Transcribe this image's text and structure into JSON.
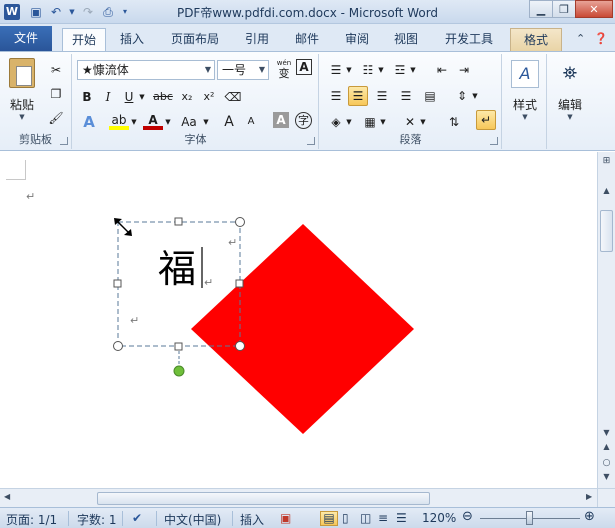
{
  "window": {
    "title": "PDF帝www.pdfdi.com.docx  -  Microsoft Word",
    "app_icon_letter": "W",
    "qat": [
      "save-icon",
      "undo-icon",
      "redo-icon",
      "customize-icon"
    ]
  },
  "tabs": [
    "文件",
    "开始",
    "插入",
    "页面布局",
    "引用",
    "邮件",
    "审阅",
    "视图",
    "开发工具",
    "格式"
  ],
  "ribbon": {
    "clipboard": {
      "paste_label": "粘贴",
      "group_label": "剪贴板"
    },
    "font": {
      "font_name": "★慷流体",
      "font_size": "一号",
      "group_label": "字体",
      "bold": "B",
      "italic": "I",
      "underline": "U",
      "strike": "abc",
      "subscript": "x₂",
      "superscript": "x²",
      "char_scale": "Aa",
      "grow": "A",
      "shrink": "A",
      "wen_label": "wén",
      "wen_char": "变",
      "enclose_char": "字"
    },
    "paragraph": {
      "group_label": "段落"
    },
    "styles": {
      "label": "样式"
    },
    "editing": {
      "label": "编辑"
    }
  },
  "document": {
    "textbox_text": "福",
    "colors": {
      "diamond": "#ff0000",
      "rotate_handle": "#6fbf3a",
      "selection": "#5a7a9a"
    }
  },
  "statusbar": {
    "page": "页面: 1/1",
    "words": "字数: 1",
    "language": "中文(中国)",
    "mode": "插入",
    "zoom": "120%"
  }
}
